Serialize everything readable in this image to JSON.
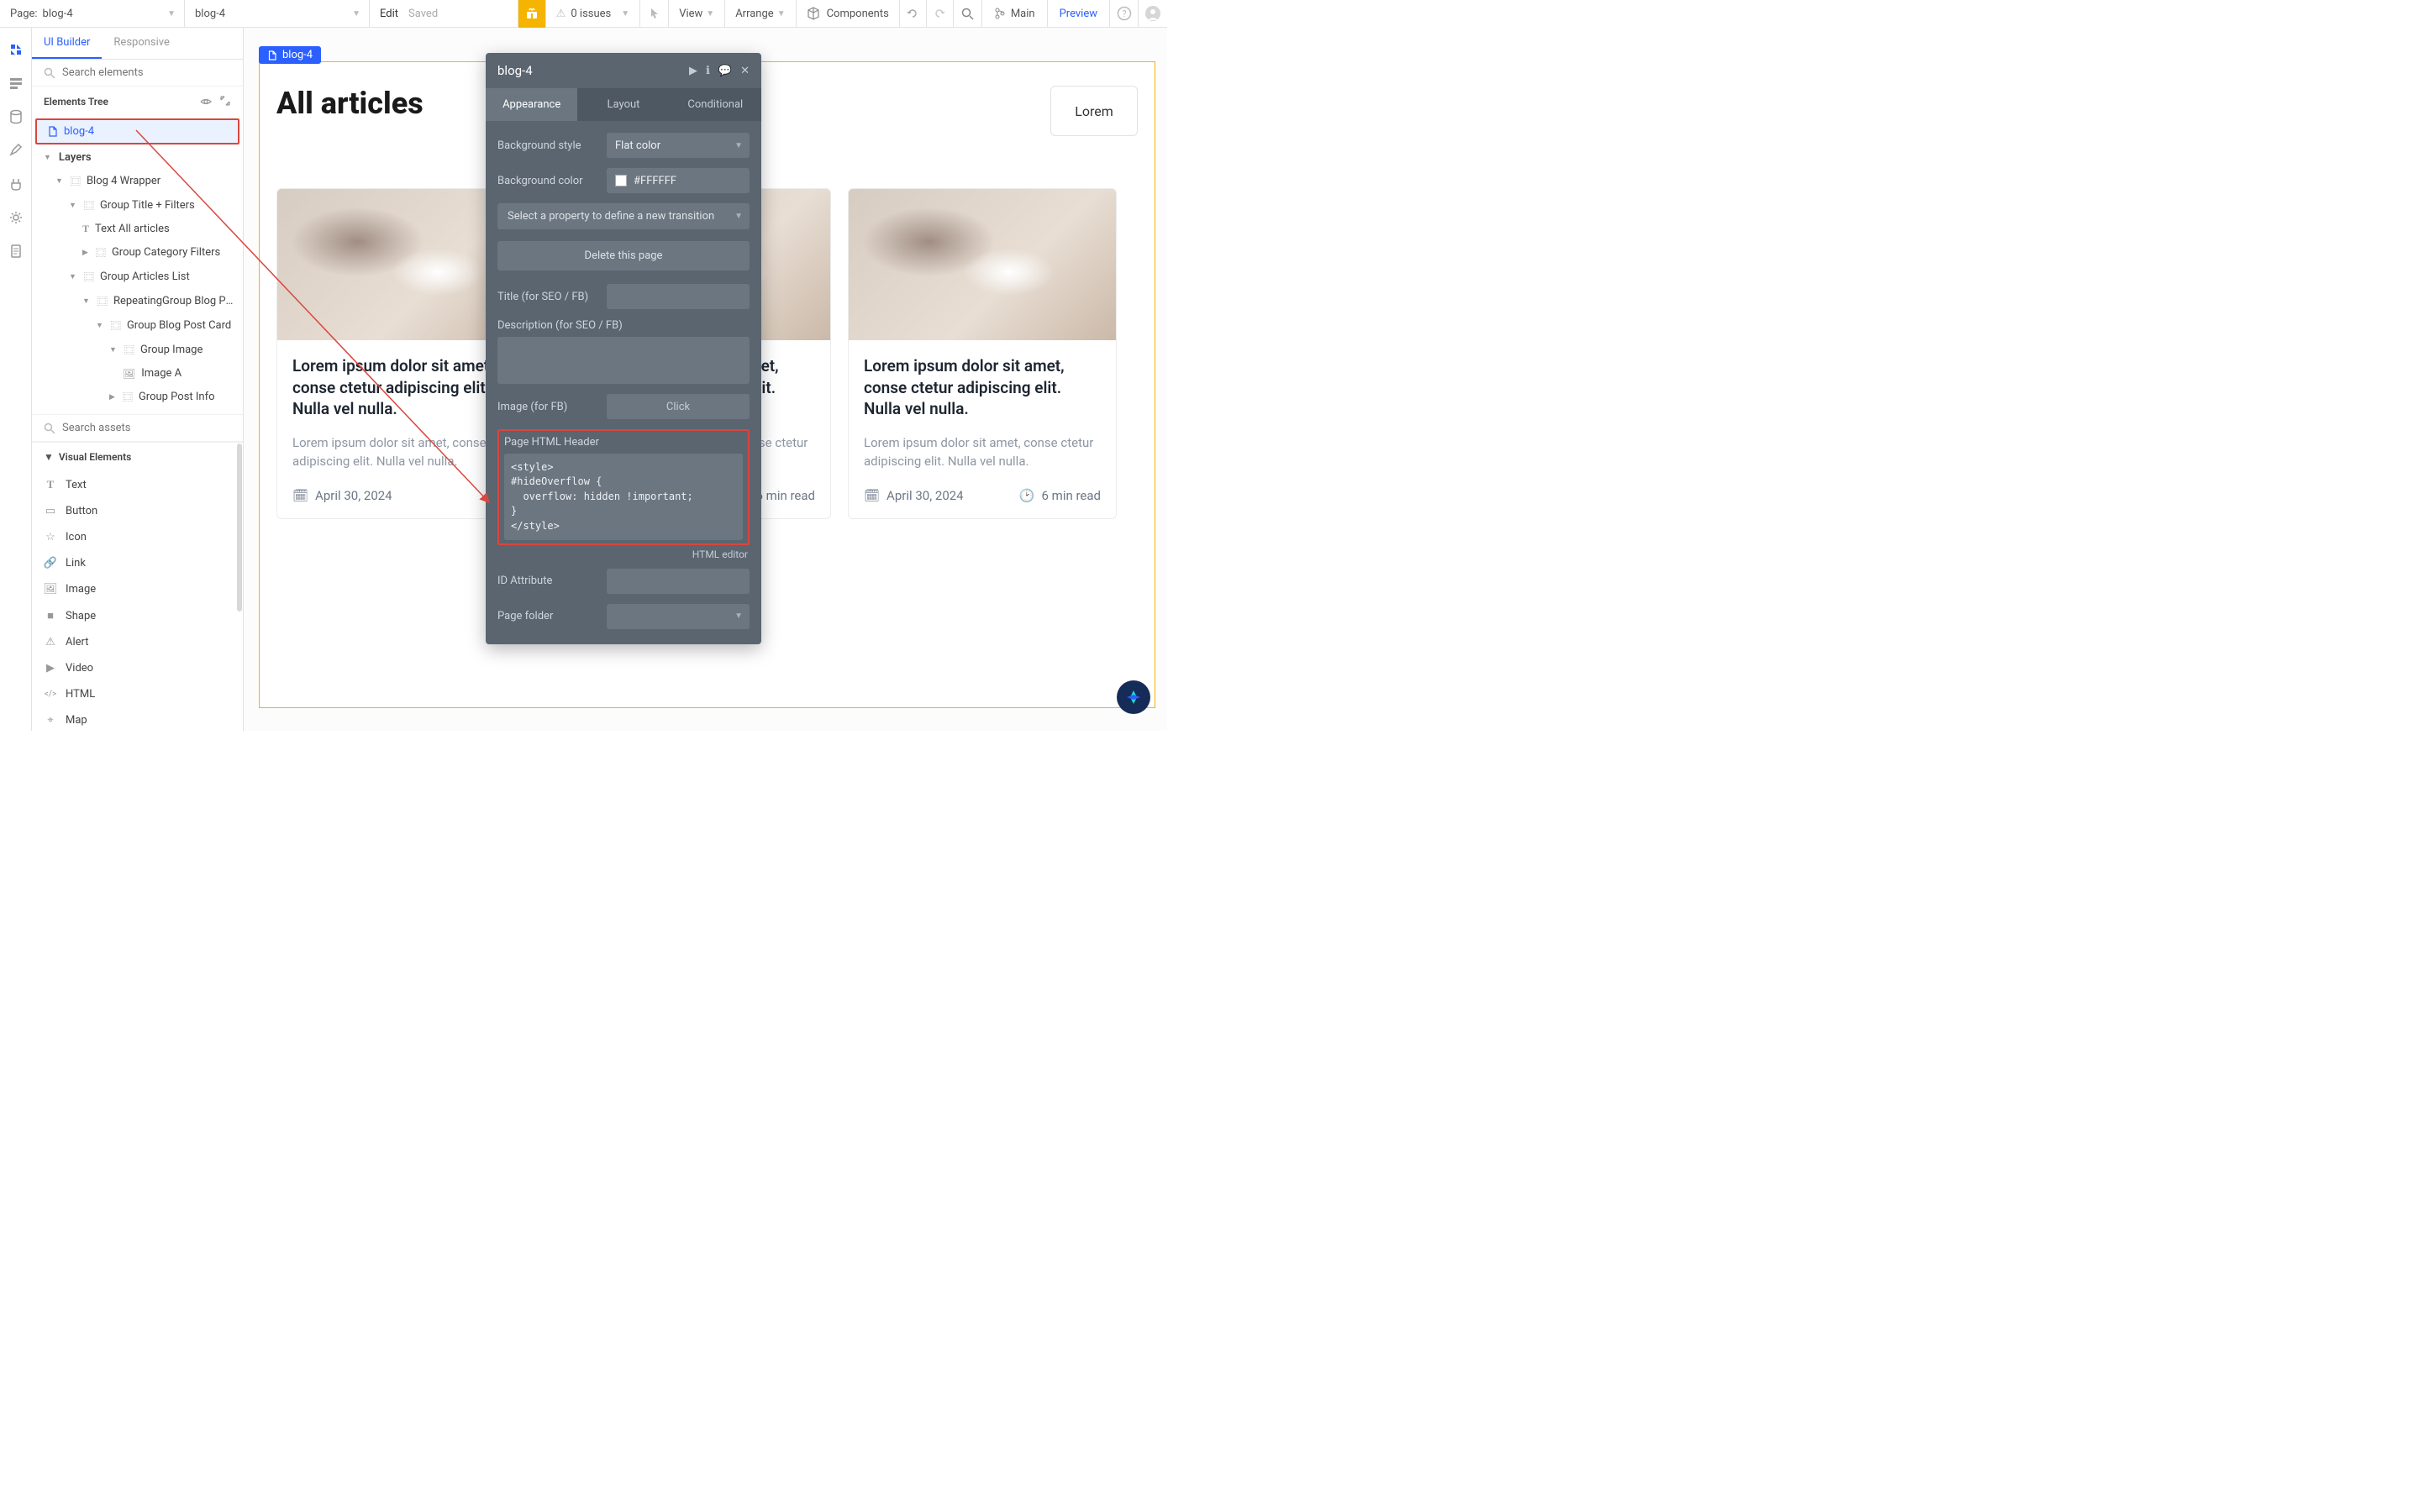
{
  "topbar": {
    "page_prefix": "Page:",
    "page_name": "blog-4",
    "element_sel": "blog-4",
    "edit": "Edit",
    "saved": "Saved",
    "issues_count": "0 issues",
    "view": "View",
    "arrange": "Arrange",
    "components": "Components",
    "main": "Main",
    "preview": "Preview"
  },
  "left": {
    "tab_ui": "UI Builder",
    "tab_resp": "Responsive",
    "search_placeholder": "Search elements",
    "elements_tree_label": "Elements Tree",
    "page_root": "blog-4",
    "layers_label": "Layers",
    "tree": {
      "wrapper": "Blog 4 Wrapper",
      "title_filters": "Group Title + Filters",
      "text_all": "Text All articles",
      "category": "Group Category Filters",
      "articles": "Group Articles List",
      "rg": "RepeatingGroup Blog Posts",
      "postcard": "Group Blog Post Card",
      "gimage": "Group Image",
      "image_a": "Image A",
      "postinfo": "Group Post Info"
    },
    "search_assets": "Search assets",
    "visual_elements": "Visual Elements",
    "ve": {
      "text": "Text",
      "button": "Button",
      "icon": "Icon",
      "link": "Link",
      "image": "Image",
      "shape": "Shape",
      "alert": "Alert",
      "video": "Video",
      "html": "HTML",
      "map": "Map"
    }
  },
  "canvas": {
    "tag": "blog-4",
    "h1": "All articles",
    "lorem_btn": "Lorem",
    "card": {
      "title": "Lorem ipsum dolor sit amet, conse ctetur adipiscing elit. Nulla vel nulla.",
      "desc": "Lorem ipsum dolor sit amet, conse ctetur adipiscing elit. Nulla vel nulla.",
      "date": "April 30, 2024",
      "read": "6 min read",
      "read_partial": "6"
    }
  },
  "inspector": {
    "title": "blog-4",
    "tabs": {
      "appearance": "Appearance",
      "layout": "Layout",
      "conditional": "Conditional"
    },
    "bg_style_lbl": "Background style",
    "bg_style_val": "Flat color",
    "bg_color_lbl": "Background color",
    "bg_color_val": "#FFFFFF",
    "transition": "Select a property to define a new transition",
    "delete": "Delete this page",
    "title_seo_lbl": "Title (for SEO / FB)",
    "desc_seo_lbl": "Description (for SEO / FB)",
    "image_fb_lbl": "Image (for FB)",
    "image_fb_placeholder": "Click",
    "page_html_lbl": "Page HTML Header",
    "page_html_val": "<style>\n#hideOverflow {\n  overflow: hidden !important;\n}\n</style>",
    "html_editor": "HTML editor",
    "id_attr_lbl": "ID Attribute",
    "page_folder_lbl": "Page folder"
  }
}
